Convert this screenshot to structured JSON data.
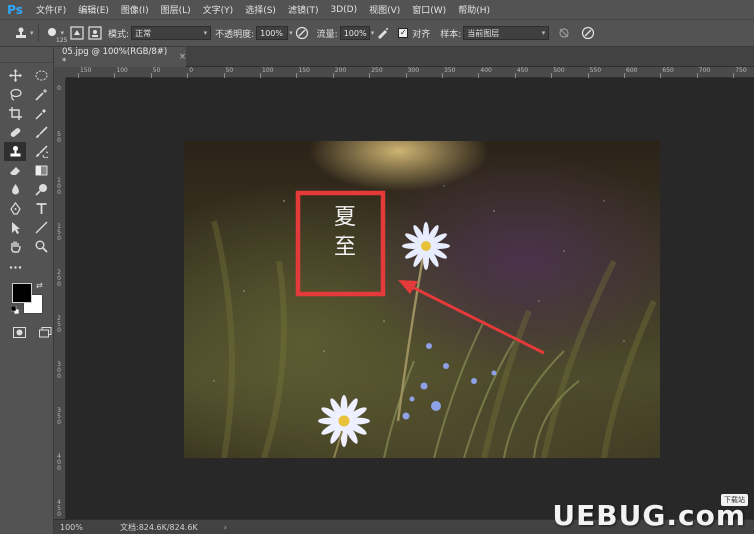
{
  "app": {
    "logo": "Ps"
  },
  "menu": [
    "文件(F)",
    "编辑(E)",
    "图像(I)",
    "图层(L)",
    "文字(Y)",
    "选择(S)",
    "滤镜(T)",
    "3D(D)",
    "视图(V)",
    "窗口(W)",
    "帮助(H)"
  ],
  "options": {
    "brush_size": "125",
    "mode_label": "模式:",
    "mode_value": "正常",
    "opacity_label": "不透明度:",
    "opacity_value": "100%",
    "flow_label": "流量:",
    "flow_value": "100%",
    "aligned_label": "对齐",
    "aligned_checked": true,
    "sample_label": "样本:",
    "sample_value": "当前图层"
  },
  "document": {
    "tab_title": "05.jpg @ 100%(RGB/8#) *",
    "close_glyph": "×"
  },
  "ruler": {
    "h_labels": [
      "150",
      "100",
      "50",
      "0",
      "50",
      "100",
      "150",
      "200",
      "250",
      "300",
      "350",
      "400",
      "450",
      "500",
      "550",
      "600",
      "650",
      "700",
      "750"
    ],
    "v_labels": [
      "0",
      "5 0",
      "1 0 0",
      "1 5 0",
      "2 0 0",
      "2 5 0",
      "3 0 0",
      "3 5 0",
      "4 0 0",
      "4 5 0"
    ]
  },
  "canvas_text": {
    "title": "夏至"
  },
  "colors": {
    "annotation_red": "#e53a3a",
    "foreground": "#000000",
    "background": "#ffffff",
    "app_bg": "#535353"
  },
  "status": {
    "zoom": "100%",
    "doc_info": "文档:824.6K/824.6K",
    "arrow": "›"
  },
  "watermark": {
    "text": "UEBUG.com",
    "badge": "下载站"
  }
}
